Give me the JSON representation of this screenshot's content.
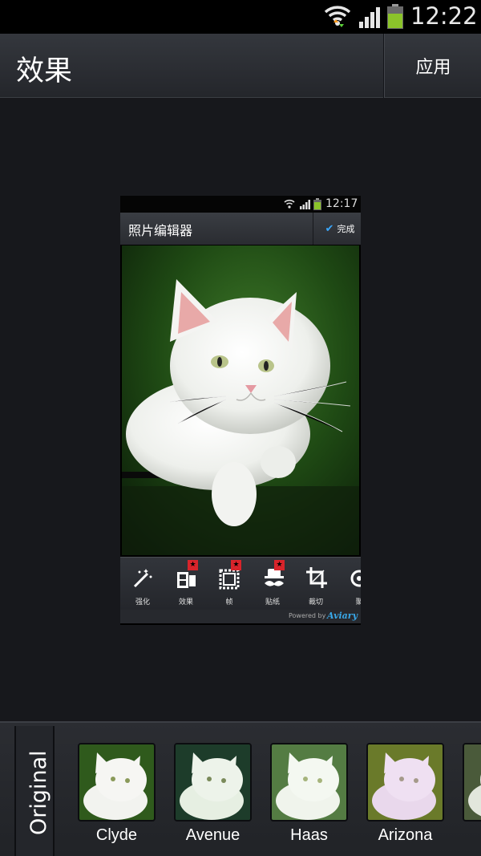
{
  "status_bar": {
    "time": "12:22"
  },
  "action_bar": {
    "title": "效果",
    "apply_label": "应用"
  },
  "preview": {
    "status_time": "12:17",
    "title": "照片编辑器",
    "done_label": "完成",
    "tools": [
      {
        "label": "强化",
        "icon": "magic-wand-icon",
        "new": false
      },
      {
        "label": "效果",
        "icon": "film-effects-icon",
        "new": true
      },
      {
        "label": "帧",
        "icon": "frame-icon",
        "new": true
      },
      {
        "label": "贴纸",
        "icon": "sticker-mustache-icon",
        "new": true
      },
      {
        "label": "裁切",
        "icon": "crop-icon",
        "new": false
      },
      {
        "label": "聚",
        "icon": "focus-icon",
        "new": false
      }
    ],
    "badge_glyph": "★",
    "powered_text": "Powered by",
    "powered_brand": "Aviary"
  },
  "effects": {
    "original_label": "Original",
    "items": [
      {
        "name": "Clyde",
        "tint": "#2f5a1c"
      },
      {
        "name": "Avenue",
        "tint": "#2e4a2a"
      },
      {
        "name": "Haas",
        "tint": "#3d6a2a"
      },
      {
        "name": "Arizona",
        "tint": "#6a7a2a"
      }
    ]
  },
  "colors": {
    "accent": "#3aa8ff",
    "badge": "#d8242b",
    "background": "#17181c"
  }
}
